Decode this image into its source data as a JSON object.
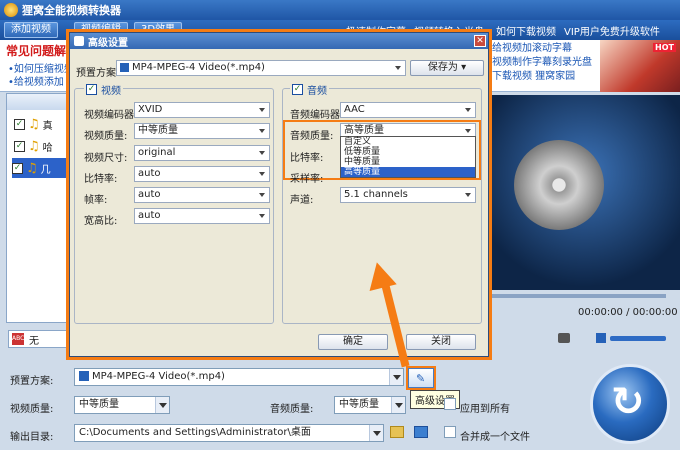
{
  "app": {
    "title": "狸窝全能视频转换器"
  },
  "menubar": {
    "add_video": "添加视频",
    "edit_video": "视频编辑",
    "effect_3d": "3D效果",
    "links": [
      "极速制作字幕",
      "视频转换入光盘",
      "如何下载视频",
      "VIP用户免费升级软件"
    ]
  },
  "ads": {
    "faq_title": "常见问题解",
    "faq_items": [
      "•如何压缩视频",
      "•给视频添加"
    ],
    "promo_lines": [
      "给视频加滚动字幕",
      "视频制作字幕刻录光盘",
      "下载视频  狸窝家园"
    ],
    "hot_badge": "HOT"
  },
  "file_list": {
    "items": [
      {
        "name": "真",
        "checked": true
      },
      {
        "name": "哈",
        "checked": true
      },
      {
        "name": "几",
        "checked": true
      }
    ]
  },
  "subtitle": {
    "value": "无"
  },
  "player": {
    "time": "00:00:00 / 00:00:00"
  },
  "bottom": {
    "preset_label": "预置方案:",
    "preset_value": "MP4-MPEG-4 Video(*.mp4)",
    "video_quality_label": "视频质量:",
    "video_quality_value": "中等质量",
    "audio_quality_label": "音频质量:",
    "audio_quality_value": "中等质量",
    "apply_all_label": "应用到所有",
    "output_label": "输出目录:",
    "output_value": "C:\\Documents and Settings\\Administrator\\桌面",
    "merge_label": "合并成一个文件",
    "tooltip": "高级设置"
  },
  "dialog": {
    "title": "高级设置",
    "preset_label": "预置方案:",
    "preset_value": "MP4-MPEG-4 Video(*.mp4)",
    "save_as": "保存为",
    "video": {
      "title": "视频",
      "fields": [
        {
          "label": "视频编码器:",
          "value": "XVID"
        },
        {
          "label": "视频质量:",
          "value": "中等质量"
        },
        {
          "label": "视频尺寸:",
          "value": "original"
        },
        {
          "label": "比特率:",
          "value": "auto"
        },
        {
          "label": "帧率:",
          "value": "auto"
        },
        {
          "label": "宽高比:",
          "value": "auto"
        }
      ]
    },
    "audio": {
      "title": "音频",
      "fields": [
        {
          "label": "音频编码器:",
          "value": "AAC"
        },
        {
          "label": "音频质量:",
          "value": "高等质量"
        },
        {
          "label": "比特率:",
          "value": ""
        },
        {
          "label": "采样率:",
          "value": ""
        },
        {
          "label": "声道:",
          "value": "5.1 channels"
        }
      ],
      "quality_options": [
        "自定义",
        "低等质量",
        "中等质量",
        "高等质量"
      ],
      "selected_option": "高等质量"
    },
    "ok": "确定",
    "close": "关闭"
  },
  "colors": {
    "accent": "#f57c14",
    "title_blue": "#2561b8",
    "selection": "#2c62c9"
  }
}
